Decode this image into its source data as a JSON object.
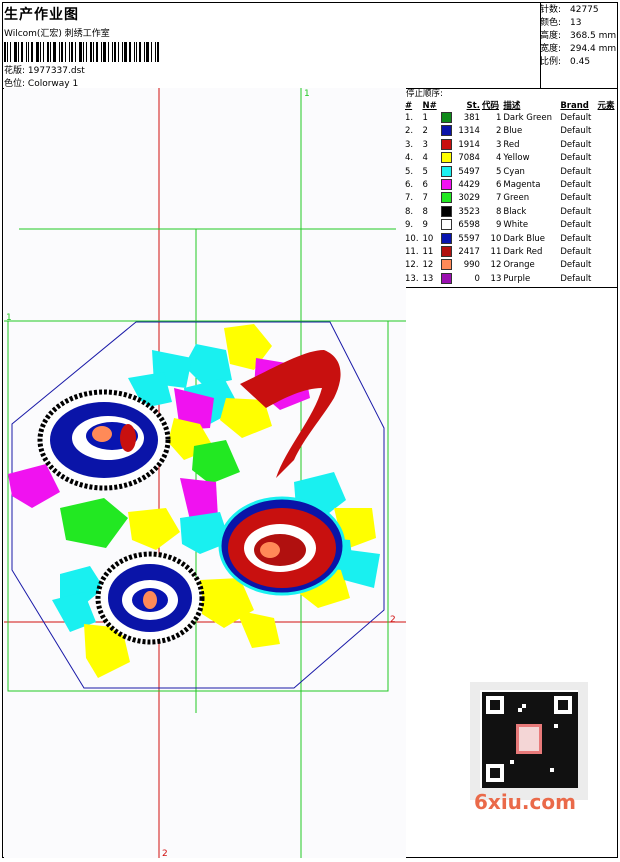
{
  "header": {
    "title": "生产作业图",
    "company": "Wilcom(汇宏) 刺绣工作室",
    "pattern_label": "花版:",
    "pattern_value": "1977337.dst",
    "colorway_label": "色位:",
    "colorway_value": "Colorway 1"
  },
  "stats": [
    {
      "label": "针数:",
      "value": "42775"
    },
    {
      "label": "颜色:",
      "value": "13"
    },
    {
      "label": "高度:",
      "value": "368.5 mm"
    },
    {
      "label": "宽度:",
      "value": "294.4 mm"
    },
    {
      "label": "比例:",
      "value": "0.45"
    }
  ],
  "legend": {
    "title": "停止顺序:",
    "headers": [
      "#",
      "N#",
      "St.",
      "代码",
      "描述",
      "Brand",
      "元素"
    ],
    "rows": [
      {
        "i": "1.",
        "n": "1",
        "st": "381",
        "code": "1",
        "desc": "Dark Green",
        "brand": "Default",
        "color": "#0f8a1a"
      },
      {
        "i": "2.",
        "n": "2",
        "st": "1314",
        "code": "2",
        "desc": "Blue",
        "brand": "Default",
        "color": "#0a14a8"
      },
      {
        "i": "3.",
        "n": "3",
        "st": "1914",
        "code": "3",
        "desc": "Red",
        "brand": "Default",
        "color": "#c8100f"
      },
      {
        "i": "4.",
        "n": "4",
        "st": "7084",
        "code": "4",
        "desc": "Yellow",
        "brand": "Default",
        "color": "#ffff00"
      },
      {
        "i": "5.",
        "n": "5",
        "st": "5497",
        "code": "5",
        "desc": "Cyan",
        "brand": "Default",
        "color": "#19f0f0"
      },
      {
        "i": "6.",
        "n": "6",
        "st": "4429",
        "code": "6",
        "desc": "Magenta",
        "brand": "Default",
        "color": "#f012f0"
      },
      {
        "i": "7.",
        "n": "7",
        "st": "3029",
        "code": "7",
        "desc": "Green",
        "brand": "Default",
        "color": "#22e822"
      },
      {
        "i": "8.",
        "n": "8",
        "st": "3523",
        "code": "8",
        "desc": "Black",
        "brand": "Default",
        "color": "#000000"
      },
      {
        "i": "9.",
        "n": "9",
        "st": "6598",
        "code": "9",
        "desc": "White",
        "brand": "Default",
        "color": "#ffffff"
      },
      {
        "i": "10.",
        "n": "10",
        "st": "5597",
        "code": "10",
        "desc": "Dark Blue",
        "brand": "Default",
        "color": "#0814b0"
      },
      {
        "i": "11.",
        "n": "11",
        "st": "2417",
        "code": "11",
        "desc": "Dark Red",
        "brand": "Default",
        "color": "#b0100f"
      },
      {
        "i": "12.",
        "n": "12",
        "st": "990",
        "code": "12",
        "desc": "Orange",
        "brand": "Default",
        "color": "#ff8a58"
      },
      {
        "i": "13.",
        "n": "13",
        "st": "0",
        "code": "13",
        "desc": "Purple",
        "brand": "Default",
        "color": "#9a10b0"
      }
    ]
  },
  "guide_marks": {
    "top": "1",
    "left": "1",
    "right": "2",
    "bottom": "2"
  },
  "watermark": "6xiu.com",
  "colors": {
    "guide_green": "#22c822",
    "guide_red": "#d01010",
    "hoop_blue": "#1a1aa8"
  }
}
